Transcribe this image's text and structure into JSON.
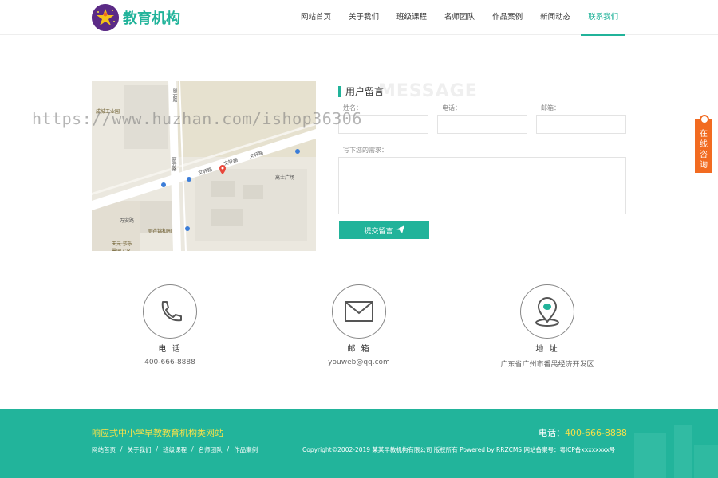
{
  "header": {
    "logo_text": "教育机构",
    "nav": [
      {
        "label": "网站首页"
      },
      {
        "label": "关于我们"
      },
      {
        "label": "班级课程"
      },
      {
        "label": "名师团队"
      },
      {
        "label": "作品案例"
      },
      {
        "label": "新闻动态"
      },
      {
        "label": "联系我们",
        "active": true
      }
    ]
  },
  "map": {
    "labels": [
      "成城工业园",
      "丽云路",
      "文轩路",
      "文轩路",
      "文轩路",
      "丽云路",
      "丽谷锦和园",
      "天元·莎乐\n景园-C区",
      "高士广场",
      "万安路"
    ]
  },
  "form": {
    "title": "用户留言",
    "watermark": "MESSAGE",
    "name_label": "姓名：",
    "phone_label": "电话：",
    "email_label": "邮箱：",
    "message_label": "写下您的需求：",
    "submit_label": "提交留言"
  },
  "online": {
    "label": "在线咨询"
  },
  "contacts": [
    {
      "title": "电 话",
      "value": "400-666-8888",
      "icon": "phone-icon"
    },
    {
      "title": "邮 箱",
      "value": "youweb@qq.com",
      "icon": "mail-icon"
    },
    {
      "title": "地 址",
      "value": "广东省广州市番禺经济开发区",
      "icon": "location-icon"
    }
  ],
  "footer": {
    "title": "响应式中小学早教教育机构类网站",
    "phone_label": "电话：",
    "phone_value": "400-666-8888",
    "links": [
      "网站首页",
      "关于我们",
      "班级课程",
      "名师团队",
      "作品案例"
    ],
    "copyright": "Copyright©2002-2019 某某早教机构有限公司 版权所有 Powered by RRZCMS  网站备案号：粤ICP备xxxxxxxx号"
  },
  "overlay_watermark": "https://www.huzhan.com/ishop36306",
  "colors": {
    "accent": "#21b39a",
    "footer_bg": "#22b49b",
    "highlight": "#f4e14a",
    "online": "#f26b21"
  }
}
